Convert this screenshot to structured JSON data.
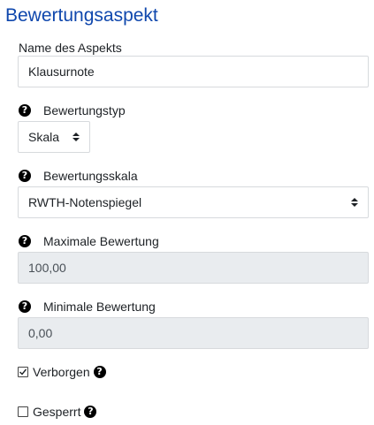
{
  "title": "Bewertungsaspekt",
  "name_field": {
    "label": "Name des Aspekts",
    "value": "Klausurnote"
  },
  "type_field": {
    "label": "Bewertungstyp",
    "value": "Skala"
  },
  "scale_field": {
    "label": "Bewertungsskala",
    "value": "RWTH-Notenspiegel"
  },
  "max_field": {
    "label": "Maximale Bewertung",
    "value": "100,00"
  },
  "min_field": {
    "label": "Minimale Bewertung",
    "value": "0,00"
  },
  "hidden_checkbox": {
    "label": "Verborgen",
    "checked": true
  },
  "locked_checkbox": {
    "label": "Gesperrt",
    "checked": false
  },
  "help_glyph": "?",
  "colors": {
    "title": "#0f47ad",
    "disabled_bg": "#e9ecef",
    "border": "#d7dadd"
  }
}
